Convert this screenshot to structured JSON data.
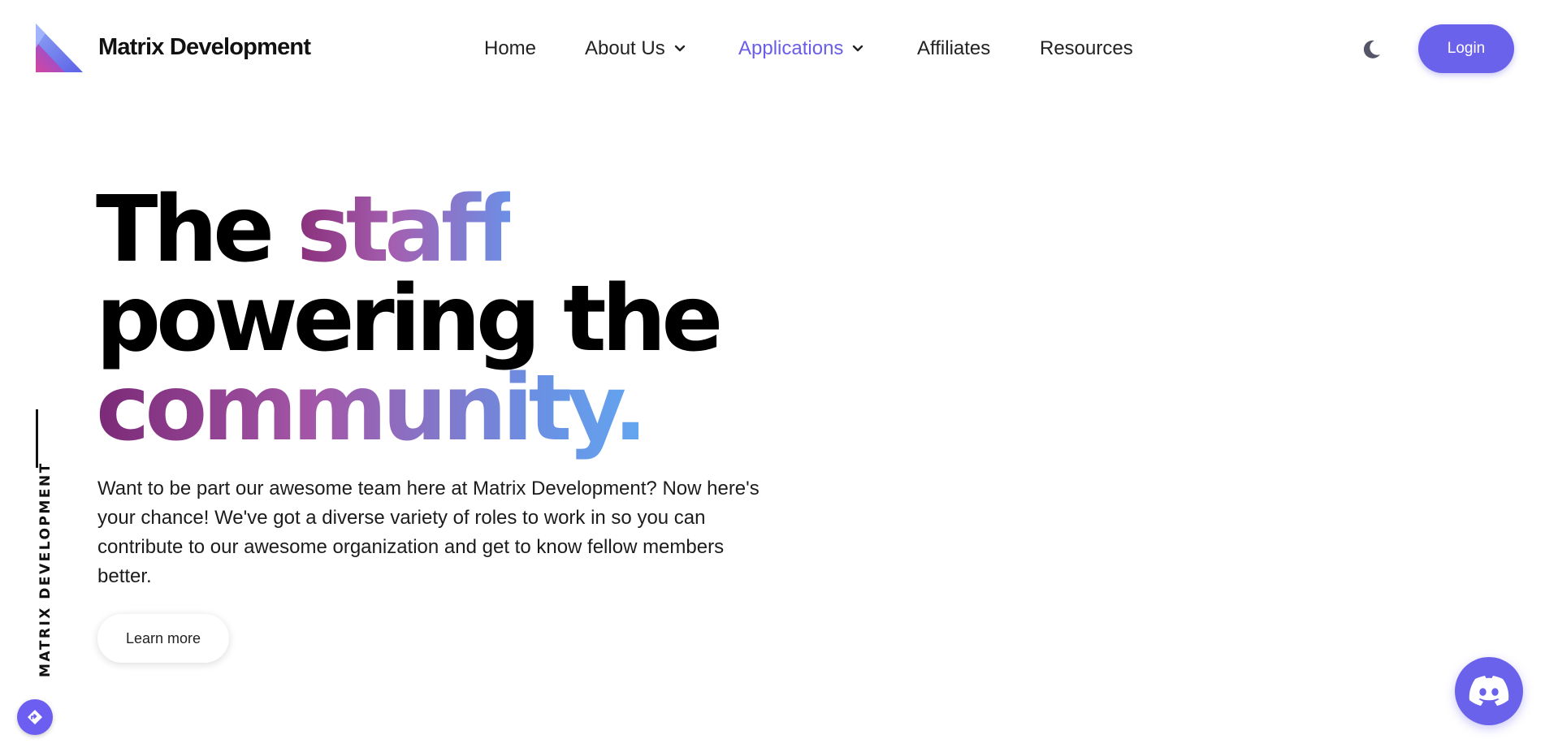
{
  "header": {
    "brand": "Matrix Development",
    "nav": [
      {
        "label": "Home",
        "dropdown": false,
        "active": false
      },
      {
        "label": "About Us",
        "dropdown": true,
        "active": false
      },
      {
        "label": "Applications",
        "dropdown": true,
        "active": true
      },
      {
        "label": "Affiliates",
        "dropdown": false,
        "active": false
      },
      {
        "label": "Resources",
        "dropdown": false,
        "active": false
      }
    ],
    "theme_toggle_icon": "moon-icon",
    "login_label": "Login"
  },
  "hero": {
    "title_line1_plain": "The ",
    "title_line1_highlight": "staff",
    "title_line2": "powering the",
    "title_line3_highlight": "community.",
    "description": "Want to be part our awesome team here at Matrix Development? Now here's your chance! We've got a diverse variety of roles to work in so you can contribute to our awesome organization and get to know fellow members better.",
    "cta_label": "Learn more"
  },
  "side": {
    "label": "MATRIX DEVELOPMENT"
  },
  "floating": {
    "corner_icon": "diamond-arrow-icon",
    "discord_icon": "discord-icon"
  },
  "colors": {
    "accent": "#6b62ec",
    "active_nav": "#6a5de7",
    "gradient_start": "#7b2a77",
    "gradient_end": "#63a6f0"
  }
}
